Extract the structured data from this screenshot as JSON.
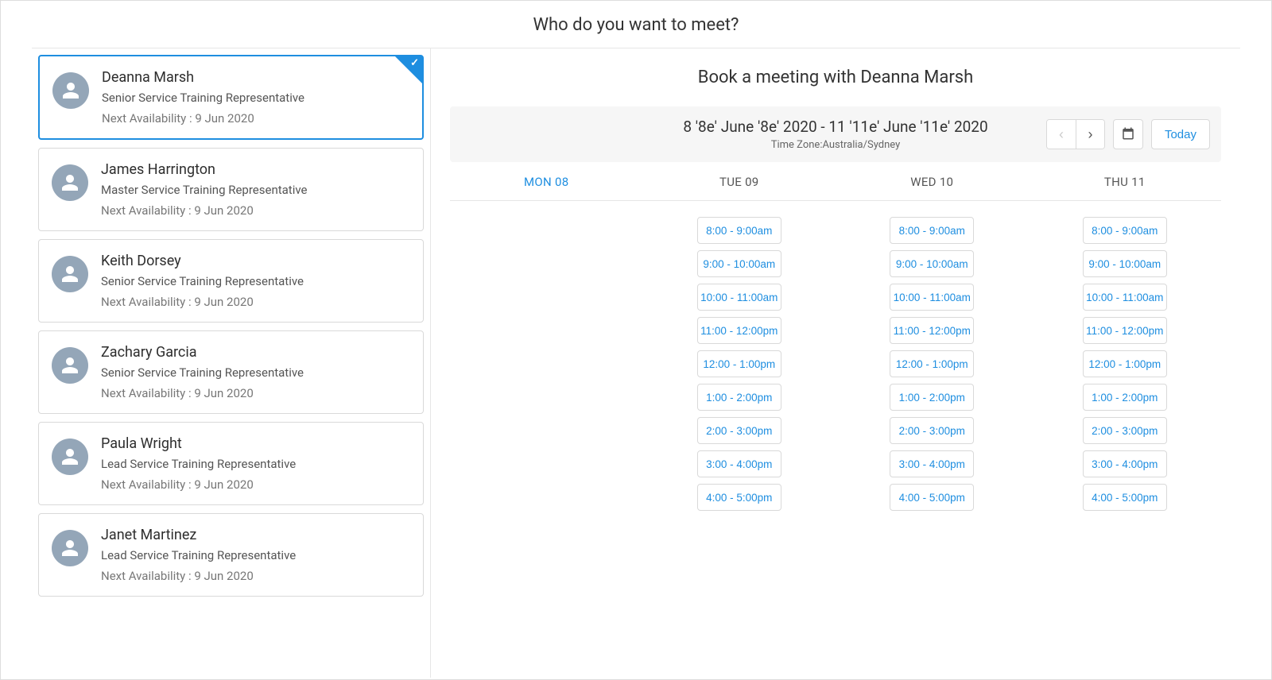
{
  "header": {
    "title": "Who do you want to meet?"
  },
  "people": [
    {
      "name": "Deanna Marsh",
      "role": "Senior Service Training Representative",
      "availability": "Next Availability : 9 Jun 2020",
      "selected": true
    },
    {
      "name": "James Harrington",
      "role": "Master Service Training Representative",
      "availability": "Next Availability : 9 Jun 2020",
      "selected": false
    },
    {
      "name": "Keith Dorsey",
      "role": "Senior Service Training Representative",
      "availability": "Next Availability : 9 Jun 2020",
      "selected": false
    },
    {
      "name": "Zachary Garcia",
      "role": "Senior Service Training Representative",
      "availability": "Next Availability : 9 Jun 2020",
      "selected": false
    },
    {
      "name": "Paula Wright",
      "role": "Lead Service Training Representative",
      "availability": "Next Availability : 9 Jun 2020",
      "selected": false
    },
    {
      "name": "Janet Martinez",
      "role": "Lead Service Training Representative",
      "availability": "Next Availability : 9 Jun 2020",
      "selected": false
    }
  ],
  "booking": {
    "title": "Book a meeting with Deanna Marsh",
    "date_range": "8 '8e' June '8e' 2020 - 11 '11e' June '11e' 2020",
    "timezone": "Time Zone:Australia/Sydney",
    "today_label": "Today"
  },
  "days": [
    {
      "label": "MON 08",
      "active": true,
      "slots": []
    },
    {
      "label": "TUE 09",
      "active": false,
      "slots": [
        "8:00 - 9:00am",
        "9:00 - 10:00am",
        "10:00 - 11:00am",
        "11:00 - 12:00pm",
        "12:00 - 1:00pm",
        "1:00 - 2:00pm",
        "2:00 - 3:00pm",
        "3:00 - 4:00pm",
        "4:00 - 5:00pm"
      ]
    },
    {
      "label": "WED 10",
      "active": false,
      "slots": [
        "8:00 - 9:00am",
        "9:00 - 10:00am",
        "10:00 - 11:00am",
        "11:00 - 12:00pm",
        "12:00 - 1:00pm",
        "1:00 - 2:00pm",
        "2:00 - 3:00pm",
        "3:00 - 4:00pm",
        "4:00 - 5:00pm"
      ]
    },
    {
      "label": "THU 11",
      "active": false,
      "slots": [
        "8:00 - 9:00am",
        "9:00 - 10:00am",
        "10:00 - 11:00am",
        "11:00 - 12:00pm",
        "12:00 - 1:00pm",
        "1:00 - 2:00pm",
        "2:00 - 3:00pm",
        "3:00 - 4:00pm",
        "4:00 - 5:00pm"
      ]
    }
  ]
}
